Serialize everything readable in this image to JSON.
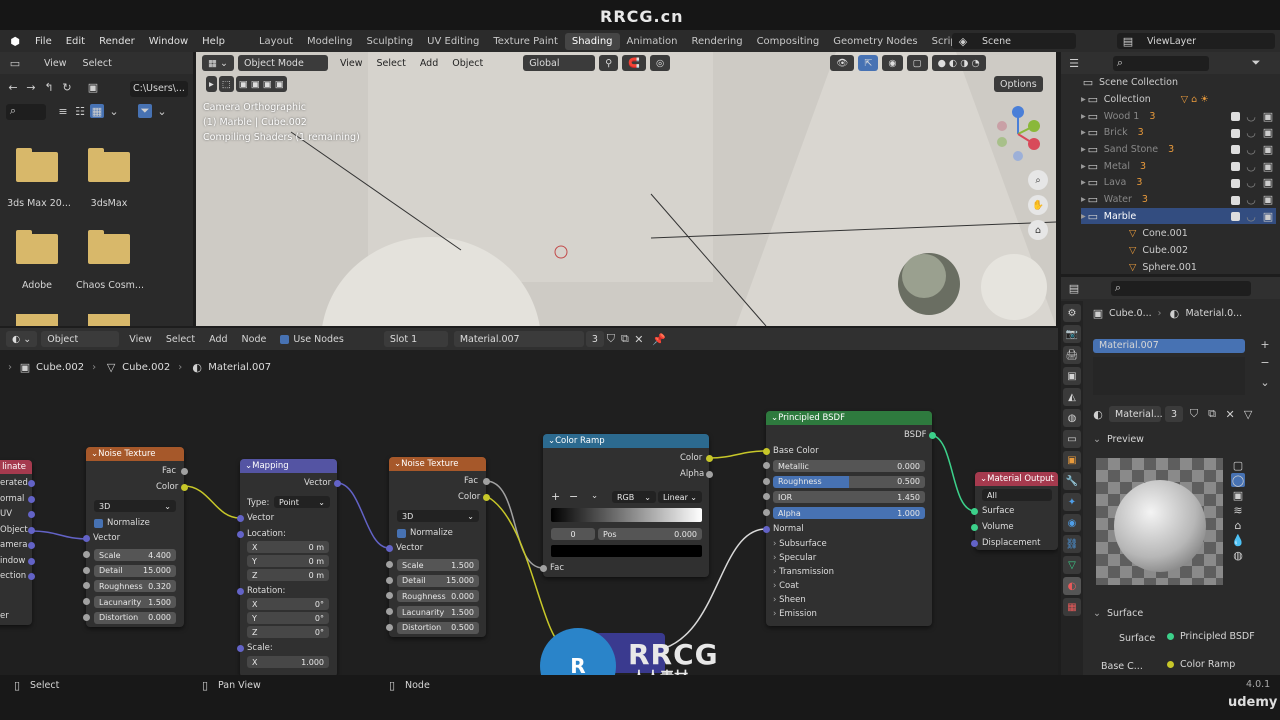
{
  "banner": {
    "title": "RRCG.cn"
  },
  "menubar": {
    "items": [
      "File",
      "Edit",
      "Render",
      "Window",
      "Help"
    ],
    "workspaces": [
      "Layout",
      "Modeling",
      "Sculpting",
      "UV Editing",
      "Texture Paint",
      "Shading",
      "Animation",
      "Rendering",
      "Compositing",
      "Geometry Nodes",
      "Scripting"
    ],
    "active_workspace": "Shading",
    "scene": "Scene",
    "view_layer": "ViewLayer"
  },
  "filebrowser": {
    "menu": [
      "View",
      "Select"
    ],
    "path": "C:\\Users\\...",
    "folders": [
      "3ds Max 20...",
      "3dsMax",
      "Adobe",
      "Chaos Cosm..."
    ]
  },
  "viewport": {
    "mode": "Object Mode",
    "menu": [
      "View",
      "Select",
      "Add",
      "Object"
    ],
    "transform": "Global",
    "options": "Options",
    "info": [
      "Camera Orthographic",
      "(1) Marble | Cube.002",
      "Compiling Shaders (1 remaining)"
    ]
  },
  "outliner": {
    "root": "Scene Collection",
    "collection": "Collection",
    "items": [
      {
        "name": "Wood 1",
        "count": "3"
      },
      {
        "name": "Brick",
        "count": "3"
      },
      {
        "name": "Sand Stone",
        "count": "3"
      },
      {
        "name": "Metal",
        "count": "3"
      },
      {
        "name": "Lava",
        "count": "3"
      },
      {
        "name": "Water",
        "count": "3"
      },
      {
        "name": "Marble",
        "count": ""
      }
    ],
    "children": [
      "Cone.001",
      "Cube.002",
      "Sphere.001"
    ]
  },
  "properties": {
    "object": "Cube.0...",
    "material_short": "Material.0...",
    "slot": "Material.007",
    "material_field": "Material...",
    "users": "3",
    "preview": "Preview",
    "surface_panel": "Surface",
    "surface_label": "Surface",
    "surface_value": "Principled BSDF",
    "base_color_label": "Base C...",
    "base_color_value": "Color Ramp",
    "version": "4.0.1"
  },
  "node_editor": {
    "object_mode": "Object",
    "menu": [
      "View",
      "Select",
      "Add",
      "Node"
    ],
    "use_nodes": "Use Nodes",
    "slot": "Slot 1",
    "material": "Material.007",
    "users": "3",
    "breadcrumb": [
      "Cube.002",
      "Cube.002",
      "Material.007"
    ]
  },
  "nodes": {
    "texcoord": {
      "title": "linate",
      "outputs": [
        "erated",
        "ormal",
        "UV",
        "Object",
        "amera",
        "indow",
        "ection"
      ],
      "extra": "er"
    },
    "noise1": {
      "title": "Noise Texture",
      "outputs": [
        "Fac",
        "Color"
      ],
      "dim": "3D",
      "normalize": "Normalize",
      "input": "Vector",
      "fields": [
        {
          "l": "Scale",
          "v": "4.400"
        },
        {
          "l": "Detail",
          "v": "15.000"
        },
        {
          "l": "Roughness",
          "v": "0.320"
        },
        {
          "l": "Lacunarity",
          "v": "1.500"
        },
        {
          "l": "Distortion",
          "v": "0.000"
        }
      ]
    },
    "mapping": {
      "title": "Mapping",
      "output": "Vector",
      "type_label": "Type:",
      "type_value": "Point",
      "input": "Vector",
      "loc_label": "Location:",
      "loc": [
        {
          "l": "X",
          "v": "0 m"
        },
        {
          "l": "Y",
          "v": "0 m"
        },
        {
          "l": "Z",
          "v": "0 m"
        }
      ],
      "rot_label": "Rotation:",
      "rot": [
        {
          "l": "X",
          "v": "0°"
        },
        {
          "l": "Y",
          "v": "0°"
        },
        {
          "l": "Z",
          "v": "0°"
        }
      ],
      "scale_label": "Scale:",
      "scale": [
        {
          "l": "X",
          "v": "1.000"
        }
      ]
    },
    "noise2": {
      "title": "Noise Texture",
      "outputs": [
        "Fac",
        "Color"
      ],
      "dim": "3D",
      "normalize": "Normalize",
      "input": "Vector",
      "fields": [
        {
          "l": "Scale",
          "v": "1.500"
        },
        {
          "l": "Detail",
          "v": "15.000"
        },
        {
          "l": "Roughness",
          "v": "0.000"
        },
        {
          "l": "Lacunarity",
          "v": "1.500"
        },
        {
          "l": "Distortion",
          "v": "0.500"
        }
      ]
    },
    "ramp": {
      "title": "Color Ramp",
      "outputs": [
        "Color",
        "Alpha"
      ],
      "mode": "RGB",
      "interp": "Linear",
      "index": "0",
      "pos_label": "Pos",
      "pos": "0.000",
      "input": "Fac"
    },
    "bsdf": {
      "title": "Principled BSDF",
      "output": "BSDF",
      "base_color": "Base Color",
      "fields": [
        {
          "l": "Metallic",
          "v": "0.000"
        },
        {
          "l": "Roughness",
          "v": "0.500"
        },
        {
          "l": "IOR",
          "v": "1.450"
        },
        {
          "l": "Alpha",
          "v": "1.000"
        }
      ],
      "normal": "Normal",
      "panels": [
        "Subsurface",
        "Specular",
        "Transmission",
        "Coat",
        "Sheen",
        "Emission"
      ]
    },
    "output": {
      "title": "Material Output",
      "target": "All",
      "inputs": [
        "Surface",
        "Volume",
        "Displacement"
      ]
    }
  },
  "statusbar": {
    "items": [
      "Select",
      "Pan View",
      "Node"
    ],
    "udemy": "udemy"
  },
  "watermark": {
    "logo": "RRCG",
    "sub": "人人素材"
  }
}
